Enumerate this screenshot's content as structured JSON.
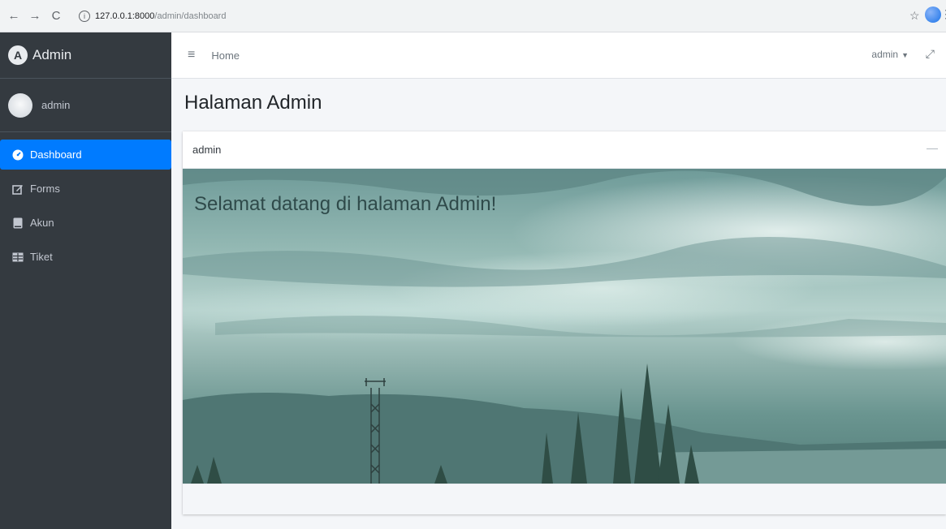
{
  "browser": {
    "url_host": "127.0.0.1:8000",
    "url_path": "/admin/dashboard"
  },
  "sidebar": {
    "brand": "Admin",
    "user_name": "admin",
    "items": [
      {
        "label": "Dashboard",
        "icon": "tachometer-icon",
        "active": true
      },
      {
        "label": "Forms",
        "icon": "edit-icon",
        "active": false
      },
      {
        "label": "Akun",
        "icon": "book-icon",
        "active": false
      },
      {
        "label": "Tiket",
        "icon": "table-icon",
        "active": false
      }
    ]
  },
  "navbar": {
    "home_link": "Home",
    "user_menu": "admin"
  },
  "main": {
    "page_title": "Halaman Admin",
    "card_title": "admin",
    "welcome_text": "Selamat datang di halaman Admin!"
  },
  "colors": {
    "sidebar_bg": "#343a40",
    "active_item": "#007bff",
    "content_bg": "#f4f6f9"
  }
}
